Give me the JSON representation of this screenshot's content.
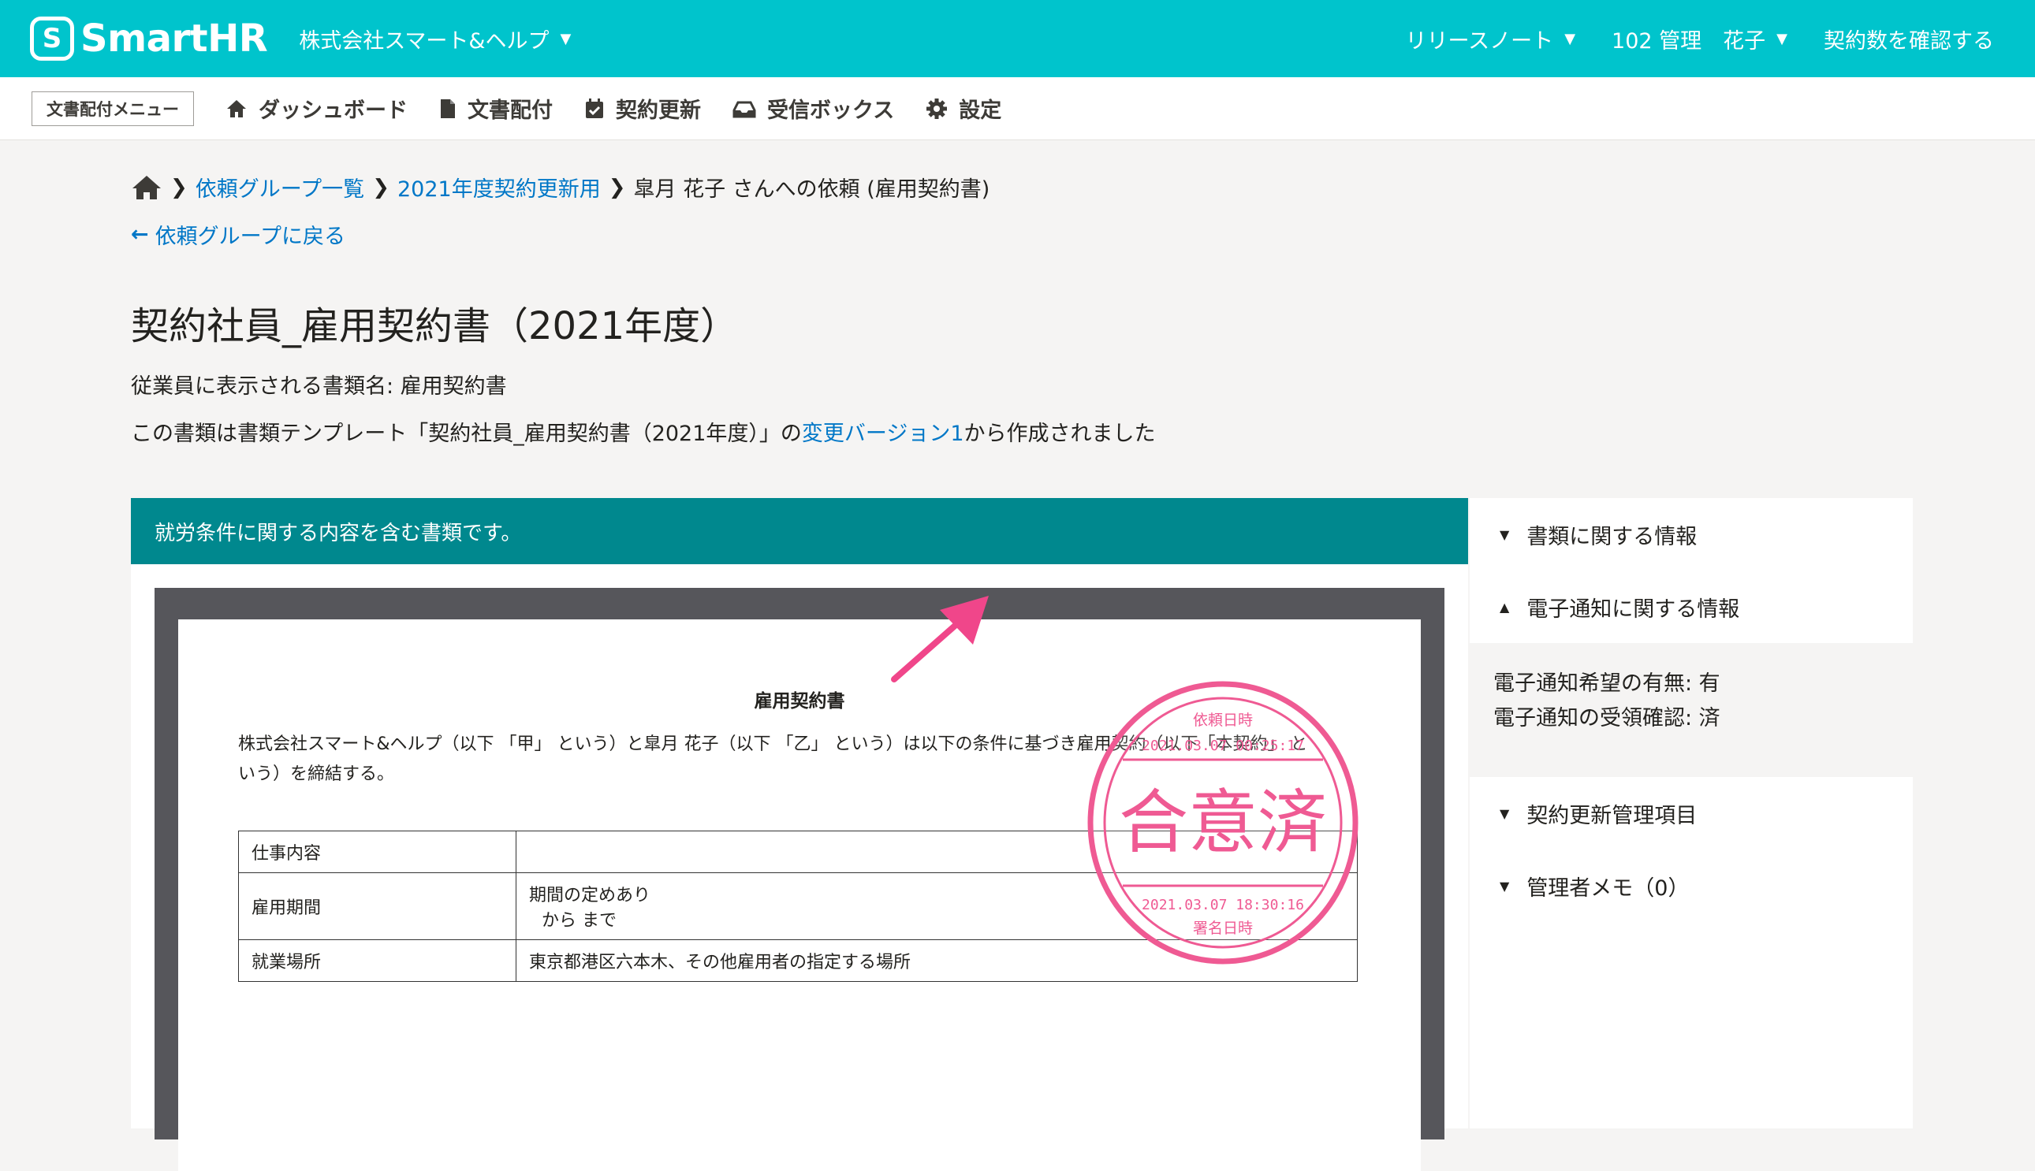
{
  "header": {
    "logo_mark": "S",
    "logo_text": "SmartHR",
    "company": "株式会社スマート&ヘルプ",
    "release_notes": "リリースノート",
    "user": "102 管理　花子",
    "check_contracts": "契約数を確認する"
  },
  "subnav": {
    "menu_tag": "文書配付メニュー",
    "items": [
      "ダッシュボード",
      "文書配付",
      "契約更新",
      "受信ボックス",
      "設定"
    ]
  },
  "breadcrumb": {
    "items": [
      "依頼グループ一覧",
      "2021年度契約更新用",
      "皐月 花子 さんへの依頼 (雇用契約書)"
    ]
  },
  "back_link": "依頼グループに戻る",
  "page": {
    "title": "契約社員_雇用契約書（2021年度）",
    "employee_doc_name": "従業員に表示される書類名: 雇用契約書",
    "template_prefix": "この書類は書類テンプレート「契約社員_雇用契約書（2021年度）」の",
    "template_link": "変更バージョン1",
    "template_suffix": "から作成されました"
  },
  "banner": "就労条件に関する内容を含む書類です。",
  "document": {
    "title": "雇用契約書",
    "paragraph": "株式会社スマート&ヘルプ（以下 「甲」 という）と皐月 花子（以下 「乙」 という）は以下の条件に基づき雇用契約（以下「本契約」 という）を締結する。",
    "rows": [
      {
        "key": "仕事内容",
        "value": ""
      },
      {
        "key": "雇用期間",
        "value": "期間の定めあり",
        "value2": "から まで"
      },
      {
        "key": "就業場所",
        "value": "東京都港区六本木、その他雇用者の指定する場所"
      }
    ]
  },
  "stamp": {
    "top_label": "依頼日時",
    "top_date": "2021.03.07 00:25:17",
    "main": "合意済",
    "bottom_date": "2021.03.07 18:30:16",
    "bottom_label": "署名日時",
    "color": "#ef5a93"
  },
  "sidebar": {
    "sections": [
      {
        "label": "書類に関する情報",
        "expanded": false
      },
      {
        "label": "電子通知に関する情報",
        "expanded": true
      },
      {
        "label": "契約更新管理項目",
        "expanded": false
      },
      {
        "label": "管理者メモ（0）",
        "expanded": false
      }
    ],
    "notification_wish": "電子通知希望の有無: 有",
    "notification_receipt": "電子通知の受領確認: 済"
  },
  "colors": {
    "brand": "#00c4cc",
    "banner": "#00888e",
    "link": "#0077c7",
    "annotation_arrow": "#f0468a"
  }
}
